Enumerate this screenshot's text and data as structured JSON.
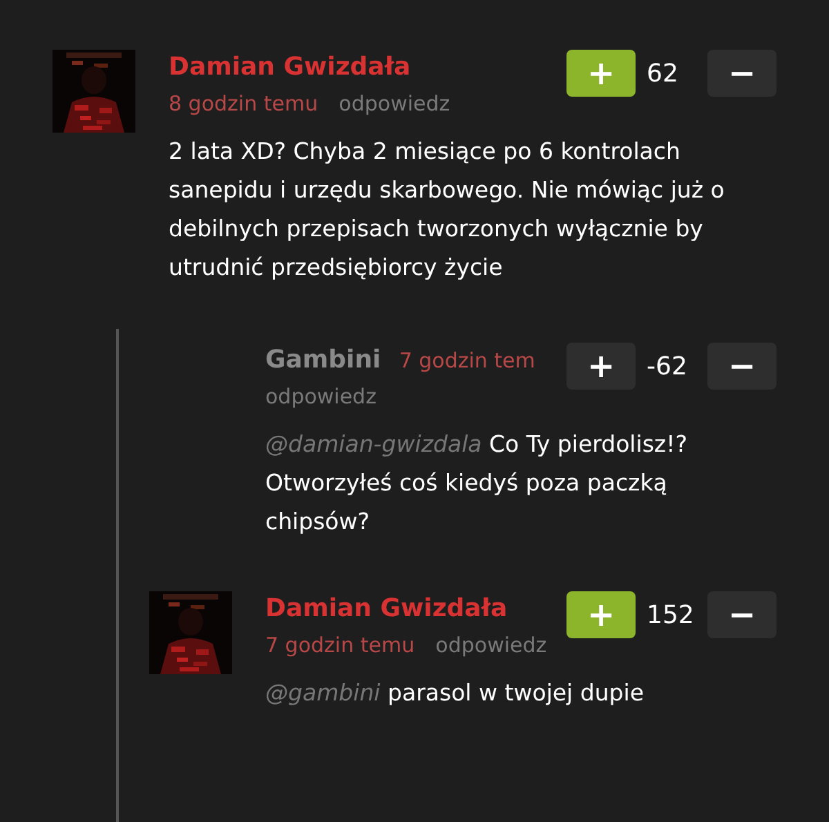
{
  "comments": [
    {
      "author": "Damian Gwizdała",
      "author_highlighted": true,
      "has_avatar": true,
      "time": "8 godzin temu",
      "reply": "odpowiedz",
      "upvote": "+",
      "upvoted": true,
      "score": "62",
      "downvote": "−",
      "text": "2 lata XD? Chyba 2 miesiące po 6 kontrolach sanepidu i urzędu skarbowego. Nie mówiąc już o debilnych przepisach tworzonych wyłącznie by utrudnić przedsiębiorcy życie",
      "children": [
        {
          "author": "Gambini",
          "author_highlighted": false,
          "has_avatar": false,
          "time": "7 godzin tem",
          "reply": "odpowiedz",
          "upvote": "+",
          "upvoted": false,
          "score": "-62",
          "downvote": "−",
          "mention": "@damian-gwizdala",
          "text": "Co Ty pierdolisz!? Otworzyłeś coś kiedyś poza paczką chipsów?"
        },
        {
          "author": "Damian Gwizdała",
          "author_highlighted": true,
          "has_avatar": true,
          "time": "7 godzin temu",
          "reply": "odpowiedz",
          "upvote": "+",
          "upvoted": true,
          "score": "152",
          "downvote": "−",
          "mention": "@gambini",
          "text": "parasol w twojej dupie"
        }
      ]
    }
  ]
}
